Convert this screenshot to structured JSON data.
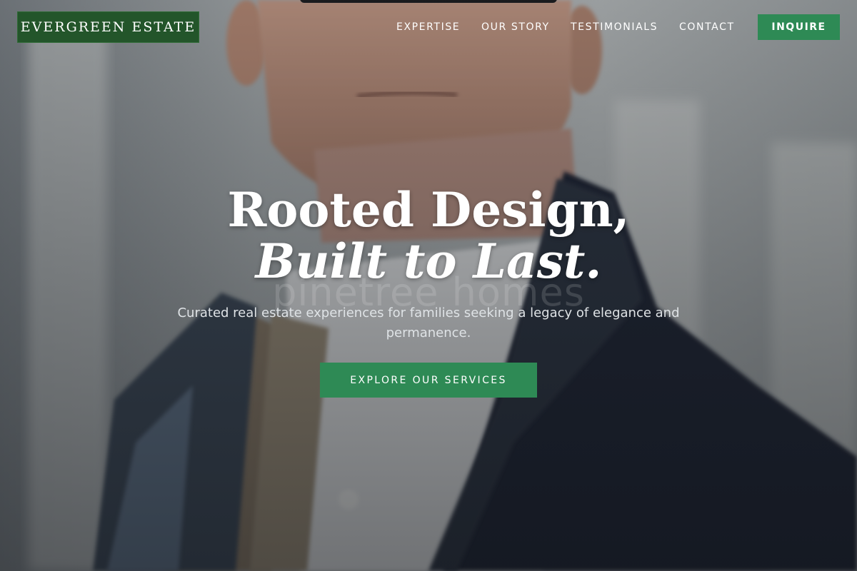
{
  "header": {
    "logo_text": "EVERGREEN ESTATE",
    "nav": [
      {
        "label": "EXPERTISE"
      },
      {
        "label": "OUR STORY"
      },
      {
        "label": "TESTIMONIALS"
      },
      {
        "label": "CONTACT"
      }
    ],
    "inquire_label": "INQUIRE"
  },
  "hero": {
    "headline_line1": "Rooted Design,",
    "headline_line2": "Built to Last.",
    "watermark": "pinetree homes",
    "subtitle": "Curated real estate experiences for families seeking a legacy of elegance and permanence.",
    "cta_label": "EXPLORE OUR SERVICES"
  },
  "colors": {
    "brand_green": "#23552a",
    "accent_green": "#2e8a55",
    "text_light": "#ffffff"
  }
}
